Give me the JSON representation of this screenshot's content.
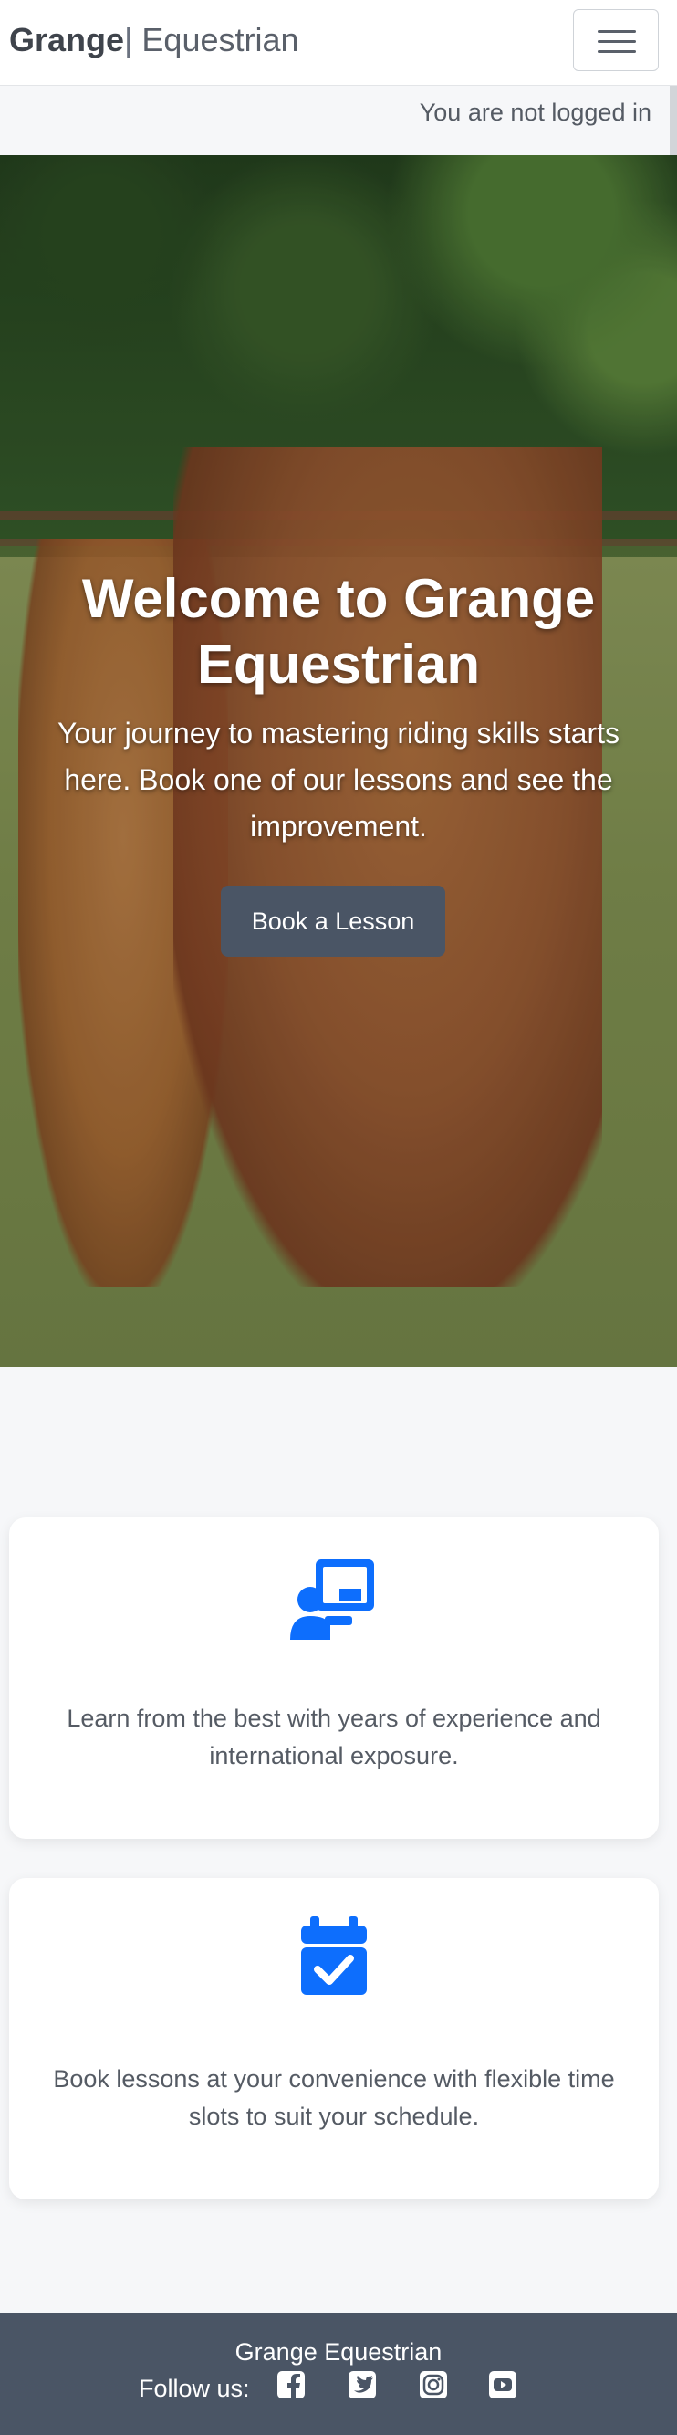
{
  "navbar": {
    "brand_strong": "Grange",
    "brand_separator": "|",
    "brand_rest": " Equestrian",
    "menu_icon": "hamburger-menu-icon"
  },
  "login_status": "You are not logged in",
  "hero": {
    "title": "Welcome to Grange Equestrian",
    "subtitle": "Your journey to mastering riding skills starts here. Book one of our lessons and see the improvement.",
    "cta_label": "Book a Lesson"
  },
  "features": [
    {
      "icon": "chalkboard-teacher-icon",
      "text": "Learn from the best with years of experience and international exposure."
    },
    {
      "icon": "calendar-check-icon",
      "text": "Book lessons at your convenience with flexible time slots to suit your schedule."
    }
  ],
  "footer": {
    "title": "Grange Equestrian",
    "follow_label": "Follow us:",
    "social": [
      "facebook-icon",
      "twitter-icon",
      "instagram-icon",
      "youtube-icon"
    ]
  },
  "colors": {
    "accent": "#0d6efd",
    "footer_bg": "#4a5565",
    "button_bg": "#4a5565",
    "page_bg": "#f6f7f9"
  }
}
